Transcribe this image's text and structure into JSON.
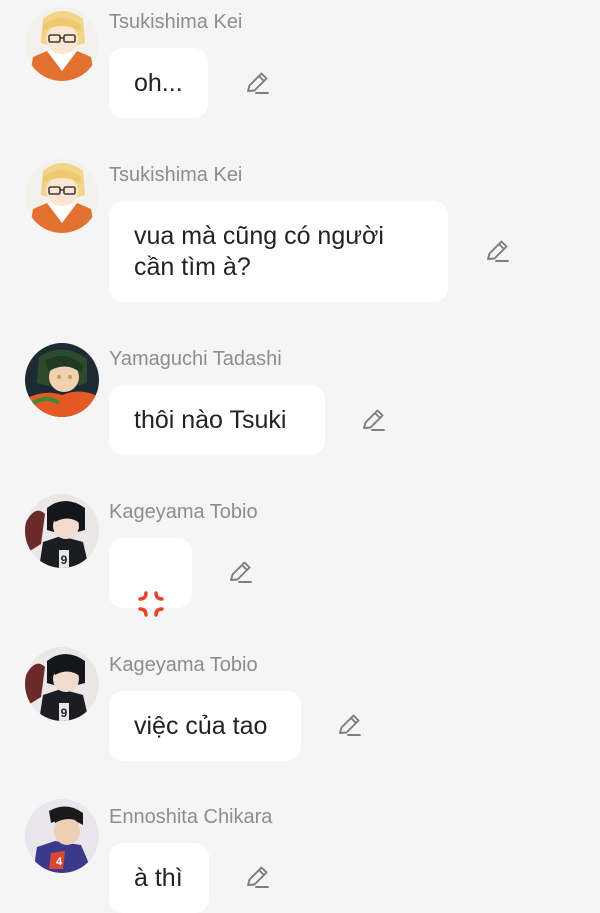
{
  "messages": [
    {
      "sender": "Tsukishima Kei",
      "text": "oh...",
      "avatar": "tsukishima-avatar",
      "edit_icon": "pencil-icon"
    },
    {
      "sender": "Tsukishima Kei",
      "text": "vua mà cũng có người\ncần tìm à?",
      "avatar": "tsukishima-avatar",
      "edit_icon": "pencil-icon"
    },
    {
      "sender": "Yamaguchi Tadashi",
      "text": "thôi nào Tsuki",
      "avatar": "yamaguchi-avatar",
      "edit_icon": "pencil-icon"
    },
    {
      "sender": "Kageyama Tobio",
      "text": "",
      "emoji": "anger-symbol",
      "avatar": "kageyama-avatar",
      "edit_icon": "pencil-icon"
    },
    {
      "sender": "Kageyama Tobio",
      "text": "việc của tao",
      "avatar": "kageyama-avatar",
      "edit_icon": "pencil-icon"
    },
    {
      "sender": "Ennoshita Chikara",
      "text": "à thì",
      "avatar": "ennoshita-avatar",
      "edit_icon": "pencil-icon"
    }
  ],
  "colors": {
    "background": "#f5f5f5",
    "bubble": "#ffffff",
    "sender_name": "#8d8d8d",
    "message_text": "#222222",
    "anger_emoji": "#e8412c"
  }
}
